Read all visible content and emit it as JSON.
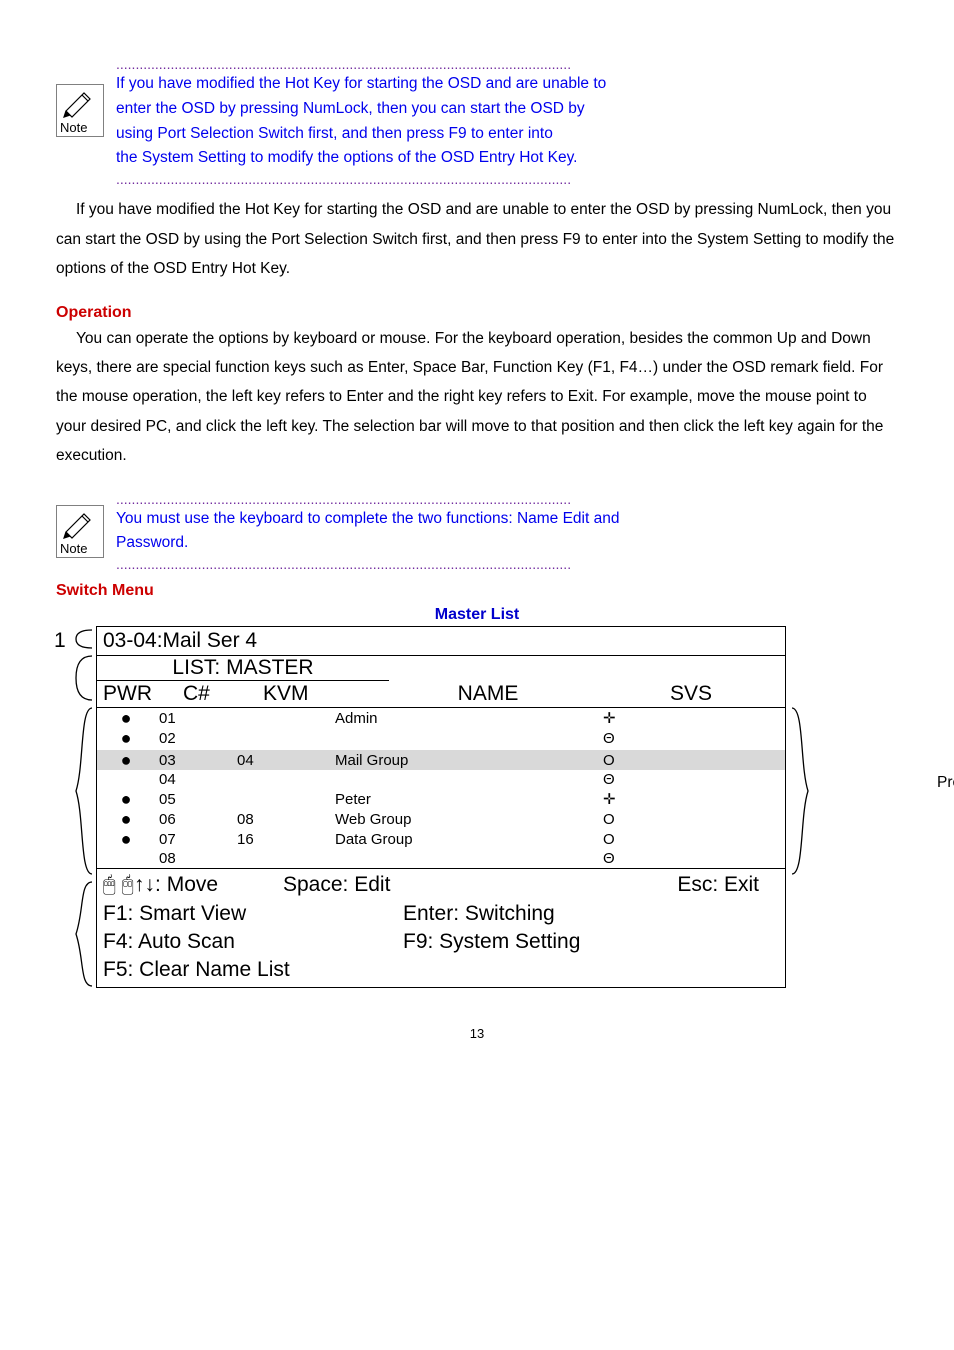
{
  "note1": {
    "l1": "If you have modified the Hot Key for starting the OSD and are unable to",
    "l2": "enter the OSD by pressing NumLock, then you can start the OSD by",
    "l3": "using Port Selection Switch first, and then press F9 to enter into",
    "l4": "the System Setting to modify the options of the OSD Entry Hot Key."
  },
  "para1": "If you have modified the Hot Key for starting the OSD and are unable to enter the OSD by pressing NumLock, then you can start the OSD by using the Port Selection Switch first, and then press F9 to enter into the System Setting to modify the options of the OSD Entry Hot Key.",
  "operation_heading": "Operation",
  "para2": "You can operate the options by keyboard or mouse. For the keyboard operation, besides the common Up and Down keys, there are special function keys such as Enter, Space Bar, Function Key (F1, F4…) under the OSD remark field. For the mouse operation, the left key refers to Enter and the right key refers to Exit. For example, move the mouse point to your desired PC, and click the left key. The selection bar will move to that position and then click the left key again for the execution.",
  "note2": {
    "l1": "You must use the keyboard to complete the two functions: Name Edit and",
    "l2": "Password."
  },
  "switch_heading": "Switch Menu",
  "master_list_heading": "Master List",
  "osd": {
    "title_row": "03-04:Mail Ser 4",
    "list_label": "LIST: MASTER",
    "h_pwr": "PWR",
    "h_cnum": "C#",
    "h_kvm": "KVM",
    "h_name": "NAME",
    "h_svs": "SVS",
    "rows": [
      {
        "pwr": "●",
        "c": "01",
        "kvm": "",
        "name": "Admin",
        "svs": "✛"
      },
      {
        "pwr": "●",
        "c": "02",
        "kvm": "",
        "name": "",
        "svs": "Θ"
      },
      {
        "pwr": "",
        "c": "",
        "kvm": "",
        "name": "",
        "svs": ""
      },
      {
        "pwr": "●",
        "c": "03",
        "kvm": "04",
        "name": "Mail Group",
        "svs": "Ο",
        "hl": true
      },
      {
        "pwr": "",
        "c": "04",
        "kvm": "",
        "name": "",
        "svs": "Θ"
      },
      {
        "pwr": "●",
        "c": "05",
        "kvm": "",
        "name": "Peter",
        "svs": "✛"
      },
      {
        "pwr": "●",
        "c": "06",
        "kvm": "08",
        "name": "Web Group",
        "svs": "Ο"
      },
      {
        "pwr": "●",
        "c": "07",
        "kvm": "16",
        "name": "Data Group",
        "svs": "Ο"
      },
      {
        "pwr": "",
        "c": "08",
        "kvm": "",
        "name": "",
        "svs": "Θ"
      }
    ],
    "footer": {
      "move": "🖱 🖰↑↓: Move",
      "space": "Space: Edit",
      "esc": "Esc: Exit",
      "f1": "F1: Smart View",
      "enter": "Enter: Switching",
      "f4": "F4: Auto Scan",
      "f9": "F9: System Setting",
      "f5": "F5: Clear Name List"
    }
  },
  "side": {
    "num1": "1",
    "press_enter": "Press Enter"
  },
  "page": "13"
}
